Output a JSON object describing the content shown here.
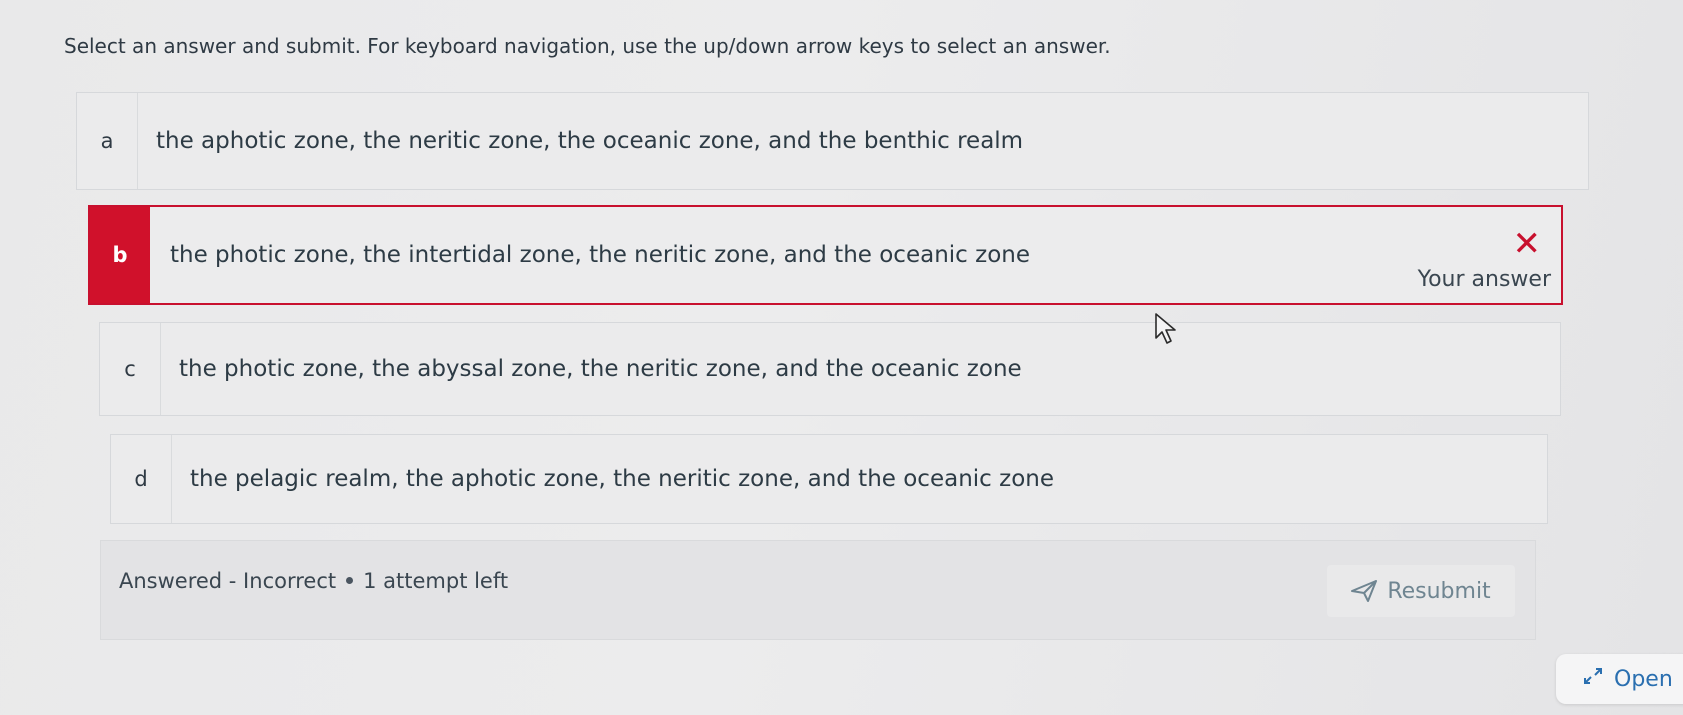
{
  "prompt": "Select an answer and submit. For keyboard navigation, use the up/down arrow keys to select an answer.",
  "options": [
    {
      "letter": "a",
      "text": "the aphotic zone, the neritic zone, the oceanic zone, and the benthic realm"
    },
    {
      "letter": "b",
      "text": "the photic zone, the intertidal zone, the neritic zone, and the oceanic zone",
      "feedback": "Your answer",
      "state": "incorrect"
    },
    {
      "letter": "c",
      "text": "the photic zone, the abyssal zone, the neritic zone, and the oceanic zone"
    },
    {
      "letter": "d",
      "text": "the pelagic realm, the aphotic zone, the neritic zone, and the oceanic zone"
    }
  ],
  "status": {
    "result": "Answered - Incorrect",
    "attempts": "1 attempt left"
  },
  "resubmit": {
    "label": "Resubmit",
    "icon": "send-icon"
  },
  "open": {
    "label": "Open",
    "icon": "expand-icon"
  },
  "colors": {
    "incorrect": "#c8102e",
    "link": "#2a6fb0"
  }
}
